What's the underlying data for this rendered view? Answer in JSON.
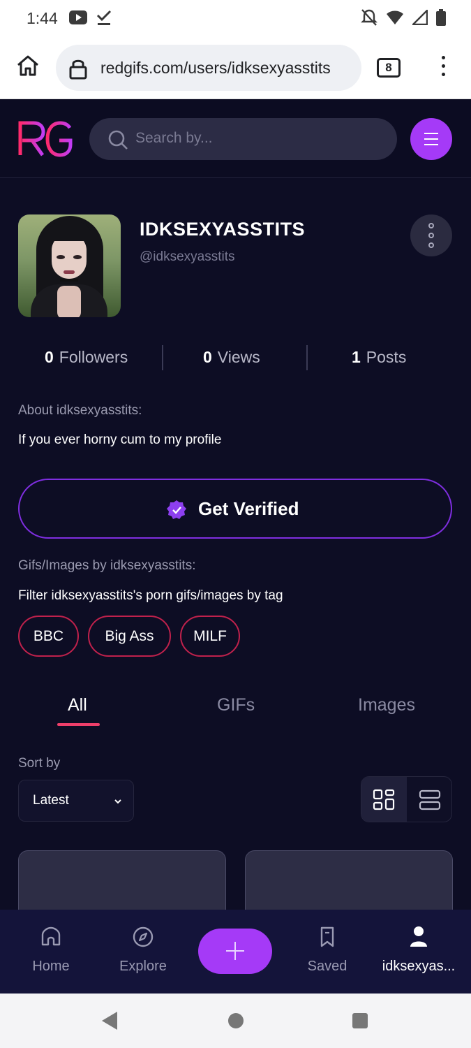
{
  "status_bar": {
    "time": "1:44"
  },
  "browser": {
    "url": "redgifs.com/users/idksexyasstits",
    "tab_count": "8"
  },
  "header": {
    "logo_text": "RG",
    "search_placeholder": "Search by..."
  },
  "profile": {
    "display_name": "IDKSEXYASSTITS",
    "handle": "@idksexyasstits",
    "stats": [
      {
        "value": "0",
        "label": "Followers"
      },
      {
        "value": "0",
        "label": "Views"
      },
      {
        "value": "1",
        "label": "Posts"
      }
    ],
    "about_label": "About idksexyasstits:",
    "about_text": "If you ever horny cum to my profile",
    "verify_label": "Get Verified",
    "gifs_label": "Gifs/Images by idksexyasstits:",
    "filter_label": "Filter idksexyasstits's porn gifs/images by tag",
    "tags": [
      "BBC",
      "Big Ass",
      "MILF"
    ]
  },
  "content_tabs": [
    "All",
    "GIFs",
    "Images"
  ],
  "active_tab": "All",
  "sort": {
    "label": "Sort by",
    "value": "Latest"
  },
  "bottom_nav": [
    {
      "label": "Home",
      "icon": "home-icon"
    },
    {
      "label": "Explore",
      "icon": "compass-icon"
    },
    {
      "label": "Saved",
      "icon": "bookmark-icon"
    },
    {
      "label": "idksexyas...",
      "icon": "user-icon"
    }
  ],
  "colors": {
    "accent": "#a53af7",
    "tag_border": "#c0214c",
    "tab_underline": "#ee3f6a",
    "background": "#0d0d24"
  }
}
